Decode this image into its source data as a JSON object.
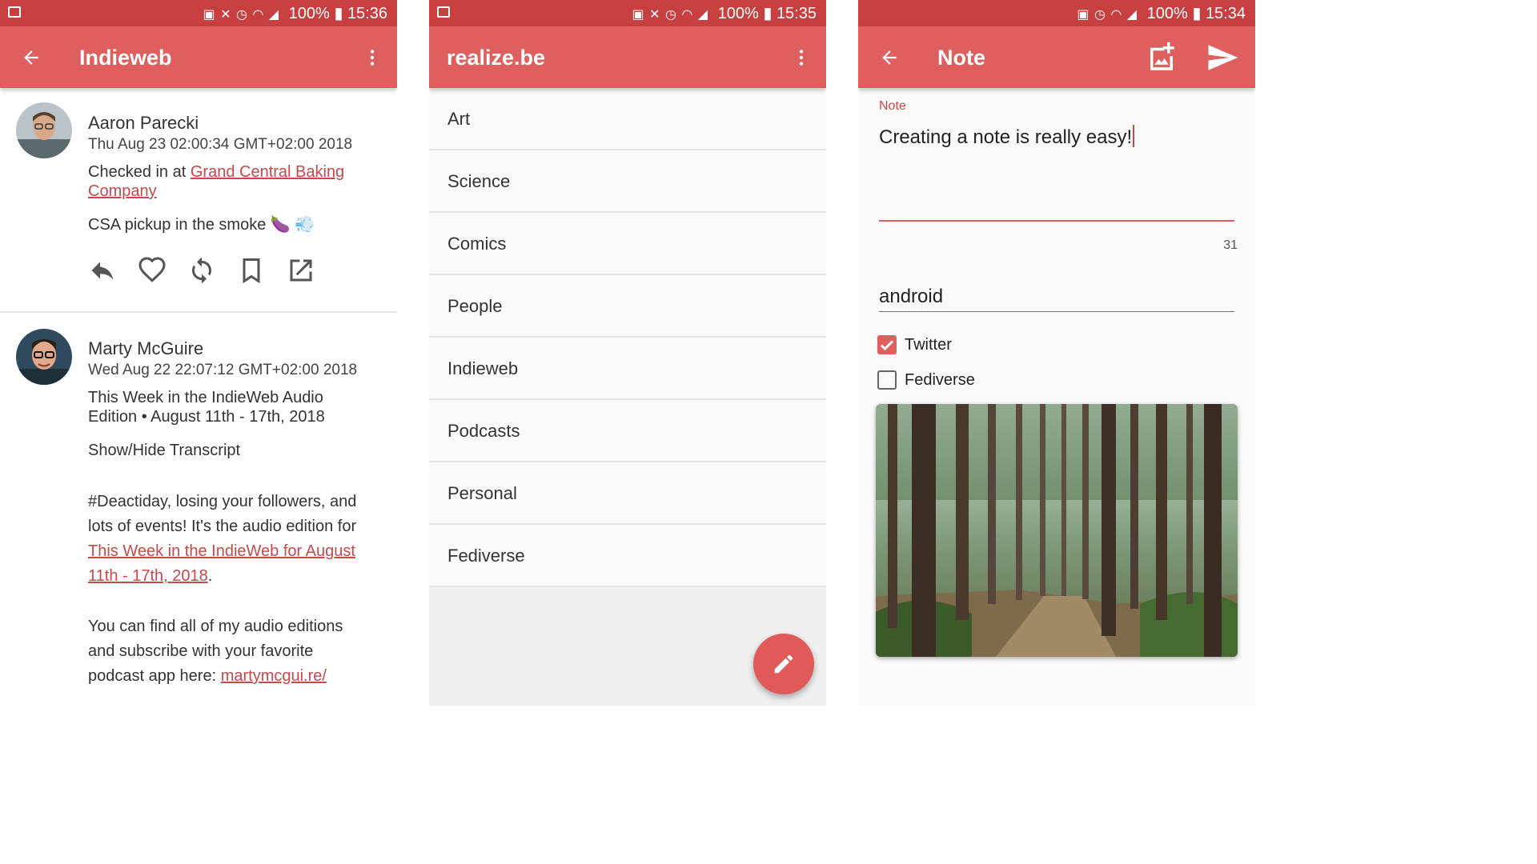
{
  "colors": {
    "statusbar": "#c7403f",
    "appbar": "#de5f5e",
    "accent": "#c9484a"
  },
  "phone1": {
    "statusbar": {
      "battery": "100%",
      "time": "15:36"
    },
    "appbar": {
      "title": "Indieweb",
      "back_icon": "arrow-left-icon",
      "menu_icon": "more-vertical-icon"
    },
    "posts": [
      {
        "author": "Aaron Parecki",
        "date": "Thu Aug 23 02:00:34 GMT+02:00 2018",
        "checkin_prefix": "Checked in at ",
        "checkin_link_1": "Grand Central Baking",
        "checkin_link_2": "Company",
        "content": "CSA pickup in the smoke",
        "content_emoji": "🍆 💨",
        "actions": [
          "reply-icon",
          "like-icon",
          "repost-icon",
          "bookmark-icon",
          "open-external-icon"
        ]
      },
      {
        "author": "Marty McGuire",
        "date": "Wed Aug 22 22:07:12 GMT+02:00 2018",
        "title_line_1": "This Week in the IndieWeb Audio",
        "title_line_2": "Edition • August 11th - 17th, 2018",
        "toggle": "Show/Hide Transcript",
        "para1_line_1": "#Deactiday, losing your followers, and",
        "para1_line_2": "lots of events! It's the audio edition for",
        "para1_link_1": "This Week in the IndieWeb for August",
        "para1_link_2": "11th - 17th, 2018",
        "para1_end": ".",
        "para2_line_1": "You can find all of my audio editions",
        "para2_line_2": "and subscribe with your favorite",
        "para2_line_3_prefix": "podcast app here: ",
        "para2_link": "martymcgui.re/"
      }
    ]
  },
  "phone2": {
    "statusbar": {
      "battery": "100%",
      "time": "15:35"
    },
    "appbar": {
      "title": "realize.be",
      "menu_icon": "more-vertical-icon"
    },
    "channels": [
      "Art",
      "Science",
      "Comics",
      "People",
      "Indieweb",
      "Podcasts",
      "Personal",
      "Fediverse"
    ],
    "fab_icon": "pencil-icon"
  },
  "phone3": {
    "statusbar": {
      "battery": "100%",
      "time": "15:34"
    },
    "appbar": {
      "title": "Note",
      "back_icon": "arrow-left-icon",
      "image_icon": "add-image-icon",
      "send_icon": "send-icon"
    },
    "note_label": "Note",
    "note_value": "Creating a note is really easy!",
    "char_count": "31",
    "tags_value": "android",
    "syndication": [
      {
        "label": "Twitter",
        "checked": true
      },
      {
        "label": "Fediverse",
        "checked": false
      }
    ],
    "photo_description": "forest-photo"
  }
}
